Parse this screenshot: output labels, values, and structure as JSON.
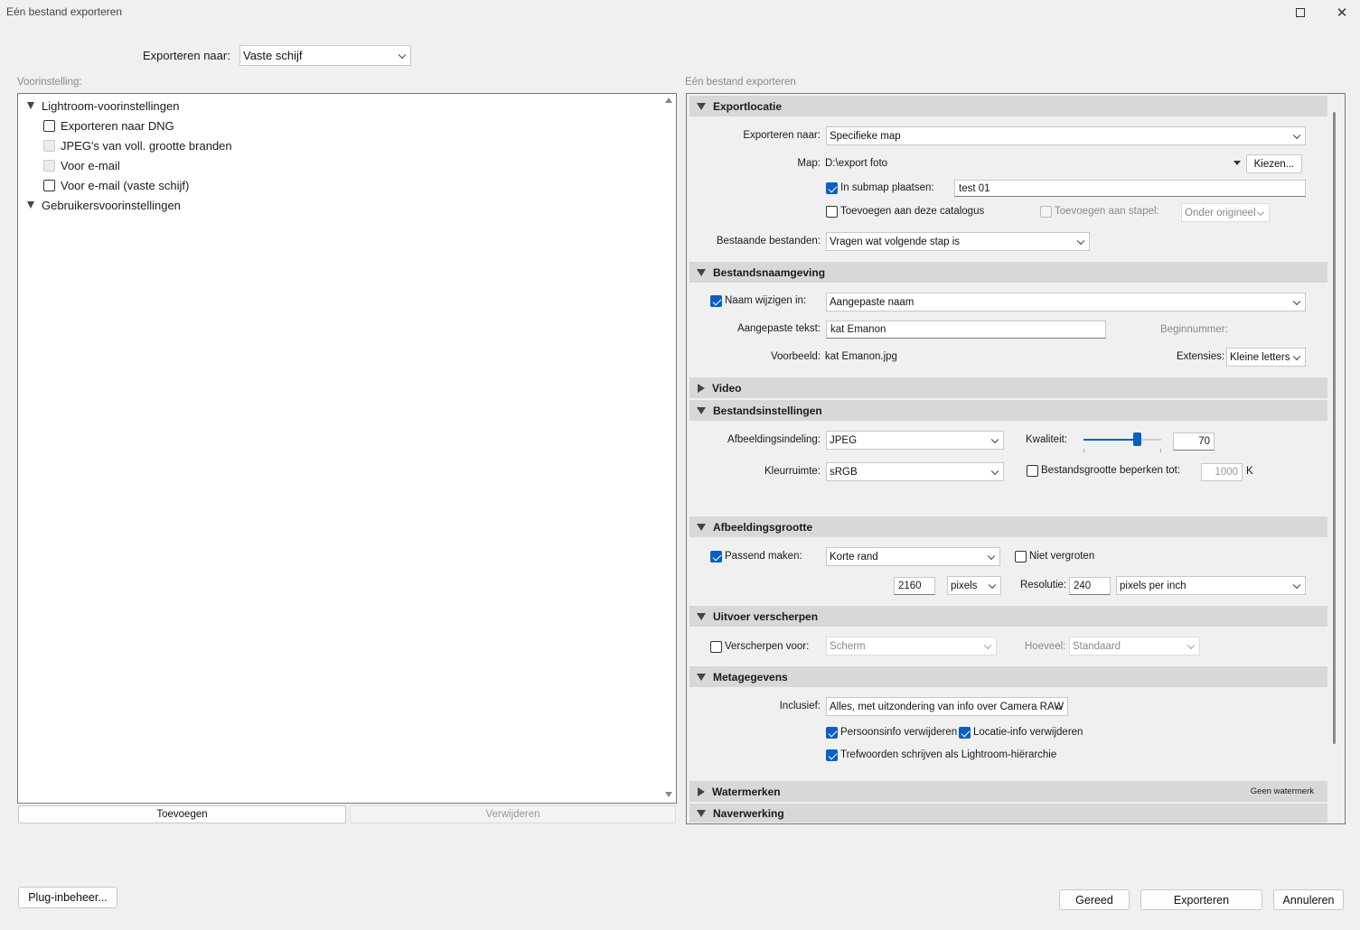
{
  "window": {
    "title": "Eén bestand exporteren",
    "maximize_icon": "maximize-icon",
    "close_icon": "close-icon",
    "close_glyph": "✕"
  },
  "top": {
    "export_to_label": "Exporteren naar:",
    "export_to_value": "Vaste schijf"
  },
  "presets": {
    "header": "Voorinstelling:",
    "groups": [
      {
        "label": "Lightroom-voorinstellingen"
      },
      {
        "label": "Gebruikersvoorinstellingen"
      }
    ],
    "items": [
      {
        "label": "Exporteren naar DNG"
      },
      {
        "label": "JPEG's van voll. grootte branden"
      },
      {
        "label": "Voor e-mail"
      },
      {
        "label": "Voor e-mail (vaste schijf)"
      }
    ],
    "add_label": "Toevoegen",
    "remove_label": "Verwijderen"
  },
  "settings": {
    "header": "Eén bestand exporteren",
    "export_location": {
      "title": "Exportlocatie",
      "export_to_label": "Exporteren naar:",
      "export_to_value": "Specifieke map",
      "folder_label": "Map:",
      "folder_value": "D:\\export foto",
      "choose_label": "Kiezen...",
      "subfolder_label": "In submap plaatsen:",
      "subfolder_value": "test 01",
      "add_catalog_label": "Toevoegen aan deze catalogus",
      "add_stack_label": "Toevoegen aan stapel:",
      "stack_value": "Onder origineel",
      "existing_label": "Bestaande bestanden:",
      "existing_value": "Vragen wat volgende stap is"
    },
    "file_naming": {
      "title": "Bestandsnaamgeving",
      "rename_label": "Naam wijzigen in:",
      "rename_value": "Aangepaste naam",
      "custom_text_label": "Aangepaste tekst:",
      "custom_text_value": "kat Emanon",
      "start_number_label": "Beginnummer:",
      "example_label": "Voorbeeld:",
      "example_value": "kat Emanon.jpg",
      "extensions_label": "Extensies:",
      "extensions_value": "Kleine letters"
    },
    "video": {
      "title": "Video"
    },
    "file_settings": {
      "title": "Bestandsinstellingen",
      "format_label": "Afbeeldingsindeling:",
      "format_value": "JPEG",
      "quality_label": "Kwaliteit:",
      "quality_value": "70",
      "quality_fraction": 0.7,
      "colorspace_label": "Kleurruimte:",
      "colorspace_value": "sRGB",
      "limit_label": "Bestandsgrootte beperken tot:",
      "limit_value": "1000",
      "limit_unit": "K"
    },
    "image_size": {
      "title": "Afbeeldingsgrootte",
      "resize_label": "Passend maken:",
      "resize_value": "Korte rand",
      "no_enlarge_label": "Niet vergroten",
      "dimension_value": "2160",
      "dimension_unit": "pixels",
      "resolution_label": "Resolutie:",
      "resolution_value": "240",
      "resolution_unit": "pixels per inch"
    },
    "sharpening": {
      "title": "Uitvoer verscherpen",
      "sharpen_label": "Verscherpen voor:",
      "sharpen_value": "Scherm",
      "amount_label": "Hoeveel:",
      "amount_value": "Standaard"
    },
    "metadata": {
      "title": "Metagegevens",
      "include_label": "Inclusief:",
      "include_value": "Alles, met uitzondering van info over Camera RAW",
      "remove_person_label": "Persoonsinfo verwijderen",
      "remove_location_label": "Locatie-info verwijderen",
      "keywords_label": "Trefwoorden schrijven als Lightroom-hiërarchie"
    },
    "watermark": {
      "title": "Watermerken",
      "value": "Geen watermerk"
    },
    "post_processing": {
      "title": "Naverwerking"
    }
  },
  "footer": {
    "plugin_label": "Plug-inbeheer...",
    "done_label": "Gereed",
    "export_label": "Exporteren",
    "cancel_label": "Annuleren"
  }
}
